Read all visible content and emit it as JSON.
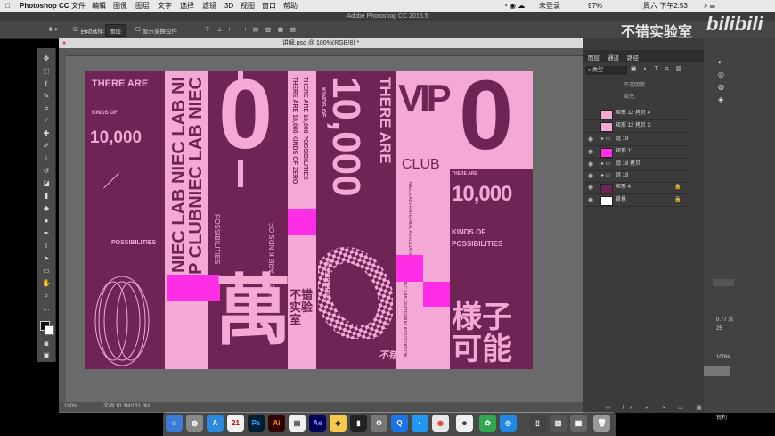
{
  "menubar": {
    "app": "Photoshop CC",
    "items": [
      "文件",
      "编辑",
      "图像",
      "图层",
      "文字",
      "选择",
      "滤镜",
      "3D",
      "视图",
      "窗口",
      "帮助"
    ],
    "status_user": "未登录",
    "battery": "97%",
    "clock": "周六 下午2:53"
  },
  "ps_title": "Adobe Photoshop CC 2015.5",
  "options": {
    "auto_select": "自动选择:",
    "auto_select_value": "图层",
    "show_transform": "显示变换控件"
  },
  "doc_tab": "讲解.psd @ 100%(RGB/8) *",
  "status": {
    "zoom": "100%",
    "doc_size": "文档:10.3M/131.8M"
  },
  "panels": {
    "tabs": [
      "图层",
      "通道",
      "路径"
    ],
    "filter_kind": "类型",
    "opacity_label": "不透明度:",
    "fill_label": "填充:",
    "layers": [
      {
        "name": "矩形 12 拷贝 4",
        "visible": false,
        "swatch": "#f3a8d6"
      },
      {
        "name": "矩形 12 拷贝 3",
        "visible": false,
        "swatch": "#f3a8d6"
      },
      {
        "name": "组 19",
        "visible": true,
        "swatch": ""
      },
      {
        "name": "矩形 11",
        "visible": true,
        "swatch": "#ff2ee6"
      },
      {
        "name": "组 18 拷贝",
        "visible": true,
        "swatch": ""
      },
      {
        "name": "组 18",
        "visible": true,
        "swatch": ""
      },
      {
        "name": "矩形 4",
        "visible": true,
        "swatch": "#6e2556"
      },
      {
        "name": "背景",
        "visible": true,
        "swatch": "#ffffff"
      }
    ]
  },
  "right_panel": {
    "val1": "0.77 点",
    "val2": "25",
    "val3": "100%",
    "val4": "锐利"
  },
  "watermark": {
    "text": "不错实验室",
    "logo": "bilibili"
  },
  "artwork": {
    "there_are": "THERE ARE",
    "kinds_of": "KINDS OF",
    "ten_thousand": "10,000",
    "possibilities": "POSSIBILITIES",
    "niec_vertical_1": "NIEC LAB NIEC LAB NI",
    "niec_vertical_2": "VIP CLUBNIEC LAB NIEC",
    "vip_club_vert": "VIP CLUB VIP CLUB",
    "big_zero": "0",
    "possibilities_vert": "POSSIBILITIES",
    "there_are_kinds": "THERE ARE KINDS OF",
    "wan": "萬",
    "col3_text1": "THERE ARE 10,000 KINDS OF ZERO",
    "col3_text2": "THERE ARE 10,000 POSSIBILITIES",
    "lab_mark": "不错实验室",
    "kinds_of_small": "KINDS OF",
    "big_10000": "10,000",
    "there_are_big": "THERE ARE",
    "vip": "VIP",
    "club": "CLUB",
    "niec_small": "NIEC LAB FRATERNAL ASSOCIATION",
    "ten_k_styled": "10,000",
    "kinds_possibilities": "KINDS OF POSSIBILITIES",
    "yangzi": "様子",
    "keneng": "可能",
    "there_are_small": "THERE ARE"
  }
}
